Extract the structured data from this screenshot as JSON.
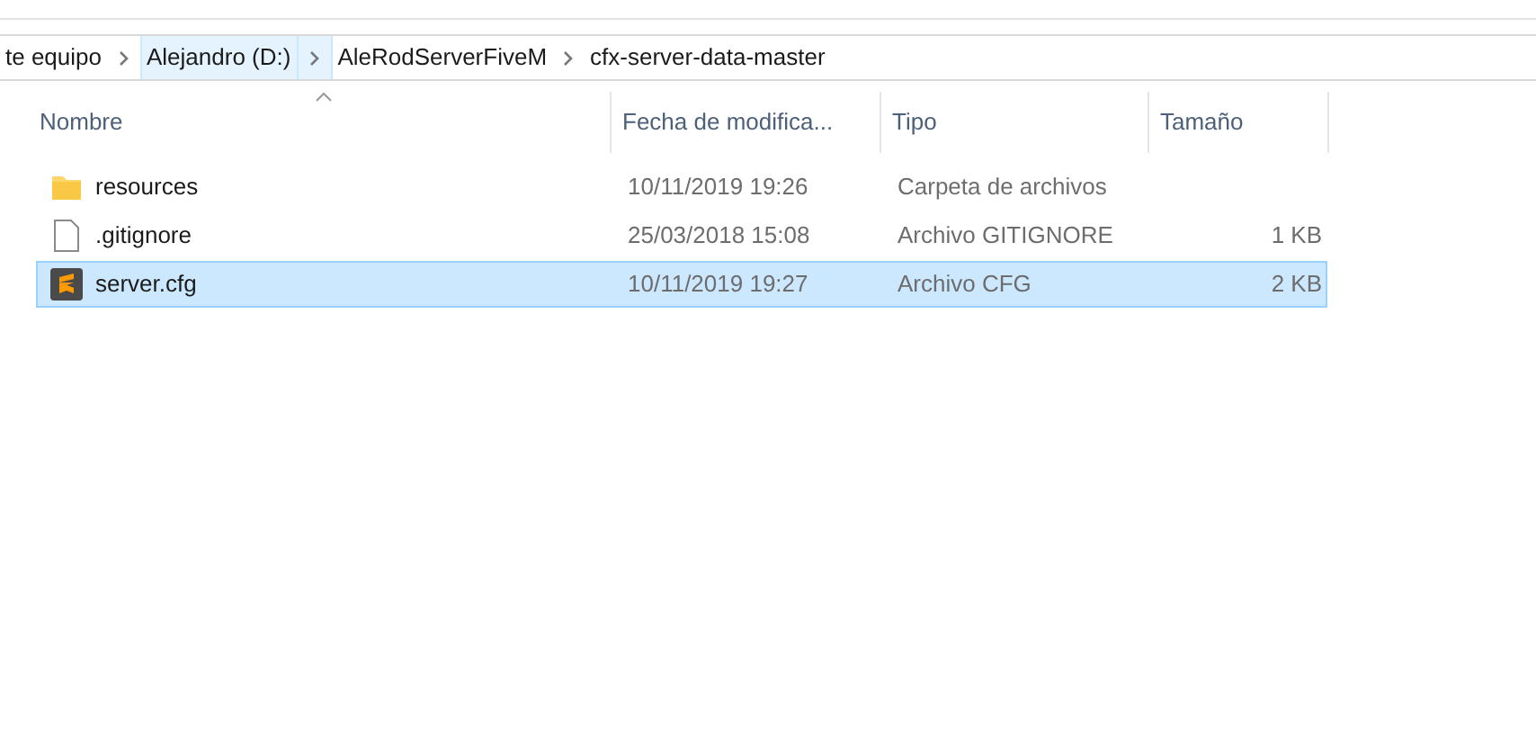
{
  "breadcrumb": [
    {
      "label": "te equipo",
      "selected": false
    },
    {
      "label": "Alejandro (D:)",
      "selected": true
    },
    {
      "label": "AleRodServerFiveM",
      "selected": false
    },
    {
      "label": "cfx-server-data-master",
      "selected": false
    }
  ],
  "columns": [
    "Nombre",
    "Fecha de modifica...",
    "Tipo",
    "Tamaño"
  ],
  "files": [
    {
      "kind": "folder",
      "name": "resources",
      "date": "10/11/2019 19:26",
      "type": "Carpeta de archivos",
      "selected": false
    },
    {
      "kind": "file",
      "name": ".gitignore",
      "date": "25/03/2018 15:08",
      "type": "Archivo GITIGNORE",
      "size": "1 KB",
      "selected": false
    },
    {
      "kind": "sublime",
      "name": "server.cfg",
      "date": "10/11/2019 19:27",
      "type": "Archivo CFG",
      "size": "2 KB",
      "selected": true
    }
  ]
}
